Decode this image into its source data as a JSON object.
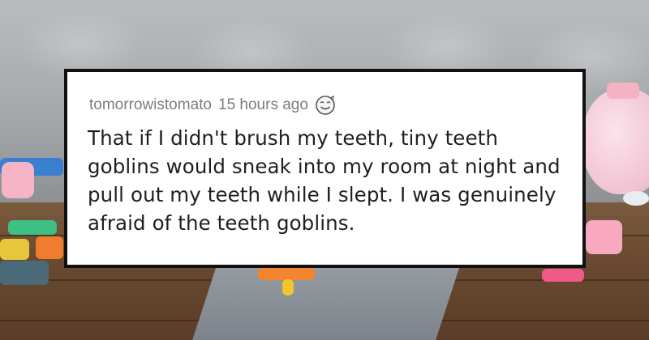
{
  "comment": {
    "username": "tomorrowistomato",
    "timestamp": "15 hours ago",
    "award_icon": "smiley-award-icon",
    "body": "That if I didn't brush my teeth, tiny teeth goblins would sneak into my room at night and pull out my teeth while I slept. I was genuinely afraid of the teeth goblins."
  },
  "colors": {
    "card_background": "#ffffff",
    "card_border": "#111111",
    "meta_text": "#7c7c7c",
    "body_text": "#1f1f1f"
  }
}
